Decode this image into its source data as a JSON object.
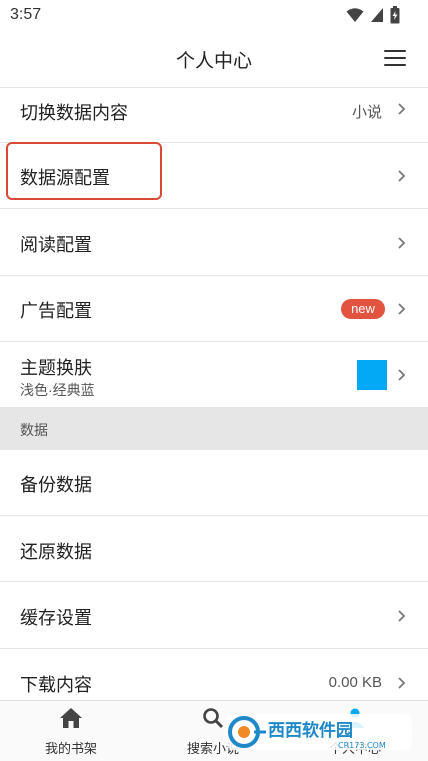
{
  "status_bar": {
    "time": "3:57"
  },
  "header": {
    "title": "个人中心"
  },
  "rows": {
    "switch_content": {
      "label": "切换数据内容",
      "value": "小说"
    },
    "data_source": {
      "label": "数据源配置"
    },
    "reading": {
      "label": "阅读配置"
    },
    "ads": {
      "label": "广告配置",
      "badge": "new"
    },
    "theme": {
      "label": "主题换肤",
      "sub": "浅色·经典蓝",
      "swatch_color": "#03a9f4"
    }
  },
  "section": {
    "label": "数据"
  },
  "data_rows": {
    "backup": {
      "label": "备份数据"
    },
    "restore": {
      "label": "还原数据"
    },
    "cache": {
      "label": "缓存设置"
    },
    "downloads": {
      "label": "下载内容",
      "value": "0.00 KB"
    }
  },
  "bottom_nav": {
    "bookshelf": "我的书架",
    "search": "搜索小说",
    "profile": "个人中心"
  },
  "watermark": {
    "brand": "西西软件园",
    "url": "CR173.COM"
  },
  "colors": {
    "accent_red": "#e25340",
    "highlight_border": "#d84a36",
    "swatch_blue": "#03a9f4"
  }
}
